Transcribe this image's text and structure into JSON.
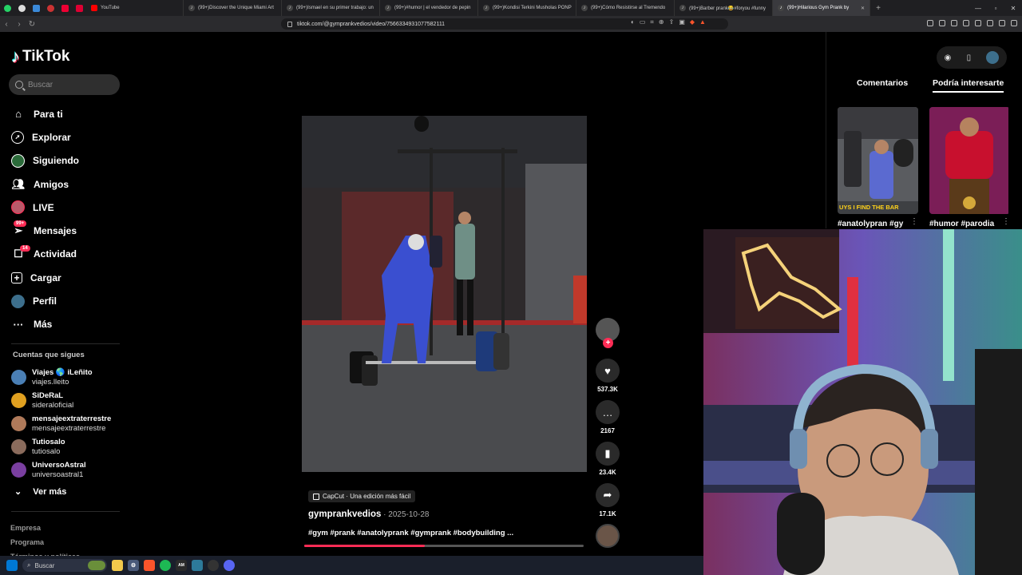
{
  "browser": {
    "tabs": [
      {
        "title": "YouTube",
        "active": false
      },
      {
        "title": "(99+)Discover the Unique Miami Art",
        "active": false
      },
      {
        "title": "(99+)Ismael en su primer trabajo: un",
        "active": false
      },
      {
        "title": "(99+)#humor | el vendedor de pepin",
        "active": false
      },
      {
        "title": "(99+)Kondisi Terkini Musholas PONP",
        "active": false
      },
      {
        "title": "(99+)Cómo Resistirse al Tremendo",
        "active": false
      },
      {
        "title": "(99+)Barber prank😂#foryou #funny",
        "active": false
      },
      {
        "title": "(99+)Hilarious Gym Prank by",
        "active": true
      }
    ],
    "url": "tiktok.com/@gymprankvedios/video/7566334931077582111"
  },
  "sidebar": {
    "logo": "TikTok",
    "search_placeholder": "Buscar",
    "nav": [
      {
        "label": "Para ti",
        "icon": "home-icon"
      },
      {
        "label": "Explorar",
        "icon": "compass-icon"
      },
      {
        "label": "Siguiendo",
        "icon": "following-icon"
      },
      {
        "label": "Amigos",
        "icon": "friends-icon"
      },
      {
        "label": "LIVE",
        "icon": "live-icon"
      },
      {
        "label": "Mensajes",
        "icon": "messages-icon",
        "badge": "99+"
      },
      {
        "label": "Actividad",
        "icon": "activity-icon",
        "badge": "14"
      },
      {
        "label": "Cargar",
        "icon": "upload-icon"
      },
      {
        "label": "Perfil",
        "icon": "profile-icon"
      },
      {
        "label": "Más",
        "icon": "more-icon"
      }
    ],
    "following_title": "Cuentas que sigues",
    "following": [
      {
        "name": "Viajes 🌎 iLeñito",
        "handle": "viajes.lleito",
        "color": "#4a7fb5"
      },
      {
        "name": "SiDeRaL",
        "handle": "sideraloficial",
        "color": "#e0a020"
      },
      {
        "name": "mensajeextraterrestre",
        "handle": "mensajeextraterrestre",
        "color": "#b07a5a"
      },
      {
        "name": "Tutiosalo",
        "handle": "tutiosalo",
        "color": "#8a6b5c"
      },
      {
        "name": "UniversoAstral",
        "handle": "universoastral1",
        "color": "#7a3fa0"
      }
    ],
    "ver_mas": "Ver más",
    "footer": [
      "Empresa",
      "Programa",
      "Términos y políticas"
    ]
  },
  "video": {
    "capcut_label": "CapCut · Una edición más fácil",
    "author": "gymprankvedios",
    "date": " · 2025-10-28",
    "hashtags": "#gym #prank #anatolyprank #gymprank #bodybuilding ...",
    "progress": 0.43
  },
  "actions": {
    "likes": "537.3K",
    "comments": "2167",
    "saves": "23.4K",
    "shares": "17.1K"
  },
  "right_panel": {
    "tabs": [
      "Comentarios",
      "Podría interesarte"
    ],
    "active_tab": "Podría interesarte",
    "thumbs": [
      {
        "title": "#anatolypran #gy",
        "caption": "UYS I FIND THE BAR"
      },
      {
        "title": "#humor #parodia",
        "caption": ""
      }
    ]
  },
  "taskbar": {
    "search_placeholder": "Buscar"
  }
}
